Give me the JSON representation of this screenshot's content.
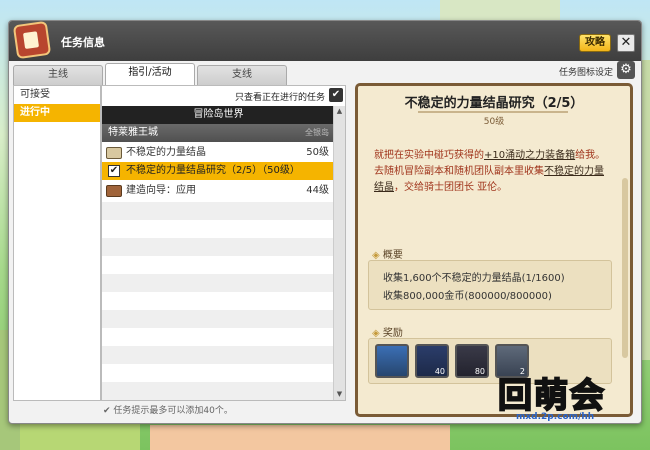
{
  "window": {
    "title": "任务信息",
    "guide_label": "攻略",
    "close_glyph": "✕",
    "settings_label": "任务图标设定",
    "gear_glyph": "⚙"
  },
  "tabs": [
    {
      "label": "主线",
      "active": false
    },
    {
      "label": "指引/活动",
      "active": true
    },
    {
      "label": "支线",
      "active": false
    }
  ],
  "sidebar": {
    "items": [
      {
        "label": "可接受",
        "active": false
      },
      {
        "label": "进行中",
        "active": true
      }
    ]
  },
  "quest_list": {
    "filter_label": "只查看正在进行的任务",
    "filter_checked": true,
    "check_glyph": "✔",
    "region": "冒险岛世界",
    "subregion": "特莱雅王城",
    "subregion_tag": "全银岛",
    "rows": [
      {
        "name": "不稳定的力量结晶",
        "level": "50级",
        "icon": "book-icon",
        "selected": false
      },
      {
        "name": "不稳定的力量结晶研究（2/5）（50级）",
        "level": "",
        "icon": "checkbox-icon",
        "selected": true
      },
      {
        "name": "建造向导：应用",
        "level": "44级",
        "icon": "book-brown-icon",
        "selected": false
      }
    ],
    "scroll_up": "▲",
    "scroll_down": "▼"
  },
  "footer": {
    "check_glyph": "✔",
    "note": "任务提示最多可以添加40个。"
  },
  "detail": {
    "title": "不稳定的力量结晶研究（2/5）",
    "level": "50级",
    "desc_1": "就把在实验中碰巧获得的",
    "desc_item": "+10涌动之力装备箱",
    "desc_2": "给我。",
    "desc_3": "去随机冒险副本和随机团队副本里收集",
    "desc_item2": "不稳定的力量结晶",
    "desc_4": "，交给骑士团团长 亚伦。",
    "summary_head": "概要",
    "summary_1": "收集1,600个不稳定的力量结晶(1/1600)",
    "summary_2": "收集800,000金币(800000/800000)",
    "reward_head": "奖励",
    "rewards": [
      {
        "icon": "treasure-chest-icon",
        "count": ""
      },
      {
        "icon": "crystal-icon",
        "count": "40"
      },
      {
        "icon": "heart-gem-icon",
        "count": "80"
      },
      {
        "icon": "scroll-icon",
        "count": "2"
      }
    ]
  },
  "watermark": {
    "logo": "回萌会",
    "url": "mxd.2p.com/hh"
  }
}
